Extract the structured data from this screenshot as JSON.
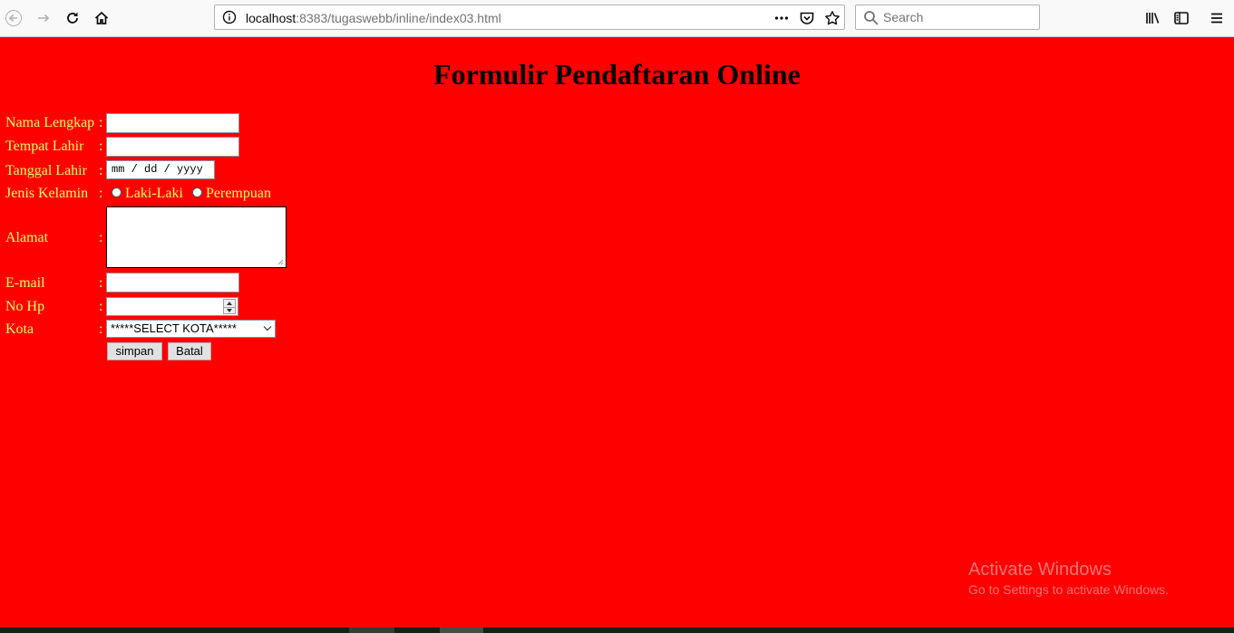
{
  "browser": {
    "url_host": "localhost",
    "url_rest": ":8383/tugaswebb/inline/index03.html",
    "search_placeholder": "Search",
    "icons": [
      "back-icon",
      "forward-icon",
      "reload-icon",
      "home-icon",
      "info-icon",
      "more-icon",
      "pocket-icon",
      "bookmark-star-icon",
      "search-icon",
      "library-icon",
      "sidebar-icon",
      "menu-icon"
    ]
  },
  "page": {
    "title": "Formulir Pendaftaran Online",
    "background_color": "#ff0000",
    "label_color": "#ffff66"
  },
  "form": {
    "colon": ":",
    "nama_label": "Nama Lengkap",
    "tempat_label": "Tempat Lahir",
    "tanggal_label": "Tanggal Lahir",
    "tanggal_placeholder": "mm / dd / yyyy",
    "jk_label": "Jenis Kelamin",
    "jk_options": [
      "Laki-Laki",
      "Perempuan"
    ],
    "alamat_label": "Alamat",
    "email_label": "E-mail",
    "hp_label": "No Hp",
    "kota_label": "Kota",
    "kota_selected": "*****SELECT KOTA*****",
    "simpan_label": "simpan",
    "batal_label": "Batal"
  },
  "watermark": {
    "line1": "Activate Windows",
    "line2": "Go to Settings to activate Windows."
  }
}
